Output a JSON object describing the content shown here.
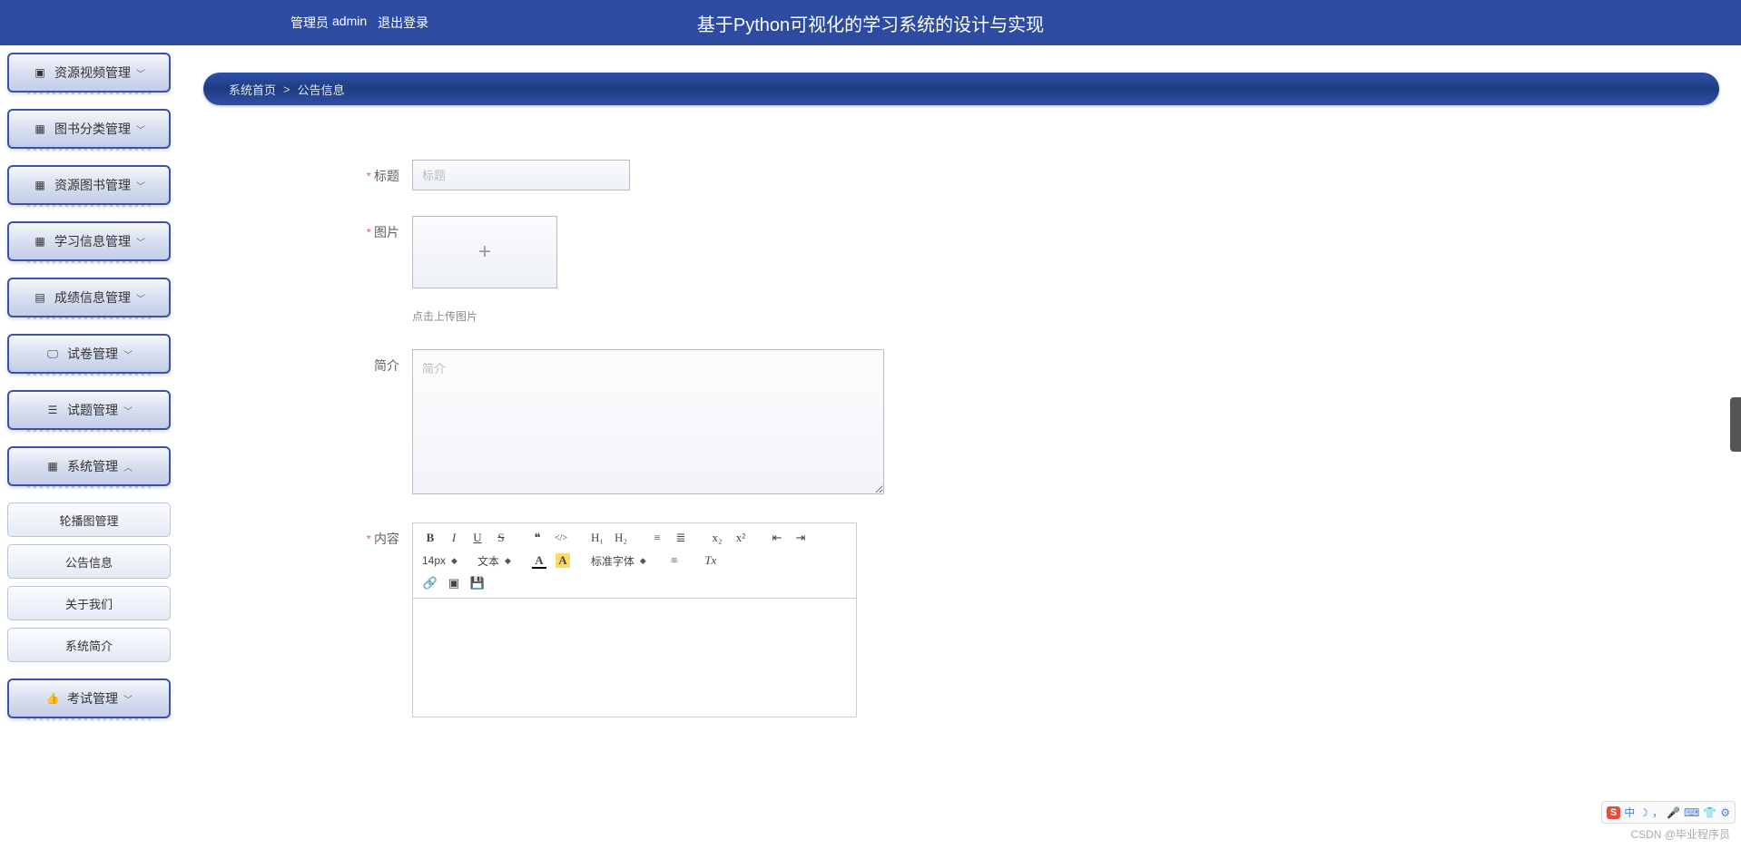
{
  "header": {
    "role_label": "管理员",
    "username": "admin",
    "logout": "退出登录",
    "title": "基于Python可视化的学习系统的设计与实现"
  },
  "sidebar": {
    "items": [
      {
        "icon": "video",
        "label": "资源视频管理",
        "expanded": false
      },
      {
        "icon": "grid",
        "label": "图书分类管理",
        "expanded": false
      },
      {
        "icon": "grid",
        "label": "资源图书管理",
        "expanded": false
      },
      {
        "icon": "grid",
        "label": "学习信息管理",
        "expanded": false
      },
      {
        "icon": "table",
        "label": "成绩信息管理",
        "expanded": false
      },
      {
        "icon": "monitor",
        "label": "试卷管理",
        "expanded": false
      },
      {
        "icon": "sliders",
        "label": "试题管理",
        "expanded": false
      },
      {
        "icon": "grid",
        "label": "系统管理",
        "expanded": true
      }
    ],
    "submenu": [
      {
        "label": "轮播图管理"
      },
      {
        "label": "公告信息"
      },
      {
        "label": "关于我们"
      },
      {
        "label": "系统简介"
      }
    ],
    "last_item": {
      "icon": "thumbs",
      "label": "考试管理",
      "expanded": false
    }
  },
  "breadcrumb": {
    "home": "系统首页",
    "sep": ">",
    "current": "公告信息"
  },
  "form": {
    "title_label": "标题",
    "title_placeholder": "标题",
    "image_label": "图片",
    "upload_hint": "点击上传图片",
    "intro_label": "简介",
    "intro_placeholder": "简介",
    "content_label": "内容"
  },
  "editor": {
    "fontsize": "14px",
    "font_family_label": "文本",
    "standard_font": "标准字体",
    "icons": {
      "bold": "B",
      "italic": "I",
      "underline": "U",
      "strike": "S",
      "quote": "❝",
      "code": "</>",
      "h1": "H₁",
      "h2": "H₂",
      "ol": "≡",
      "ul": "≣",
      "sub": "x₂",
      "sup": "x²",
      "indent_l": "⇤",
      "indent_r": "⇥",
      "color": "A",
      "highlight": "A",
      "align": "≡",
      "clear": "Tx",
      "link": "🔗",
      "image": "▣",
      "save": "💾"
    }
  },
  "watermark": "CSDN @毕业程序员",
  "ime": {
    "badge": "S",
    "lang": "中"
  }
}
